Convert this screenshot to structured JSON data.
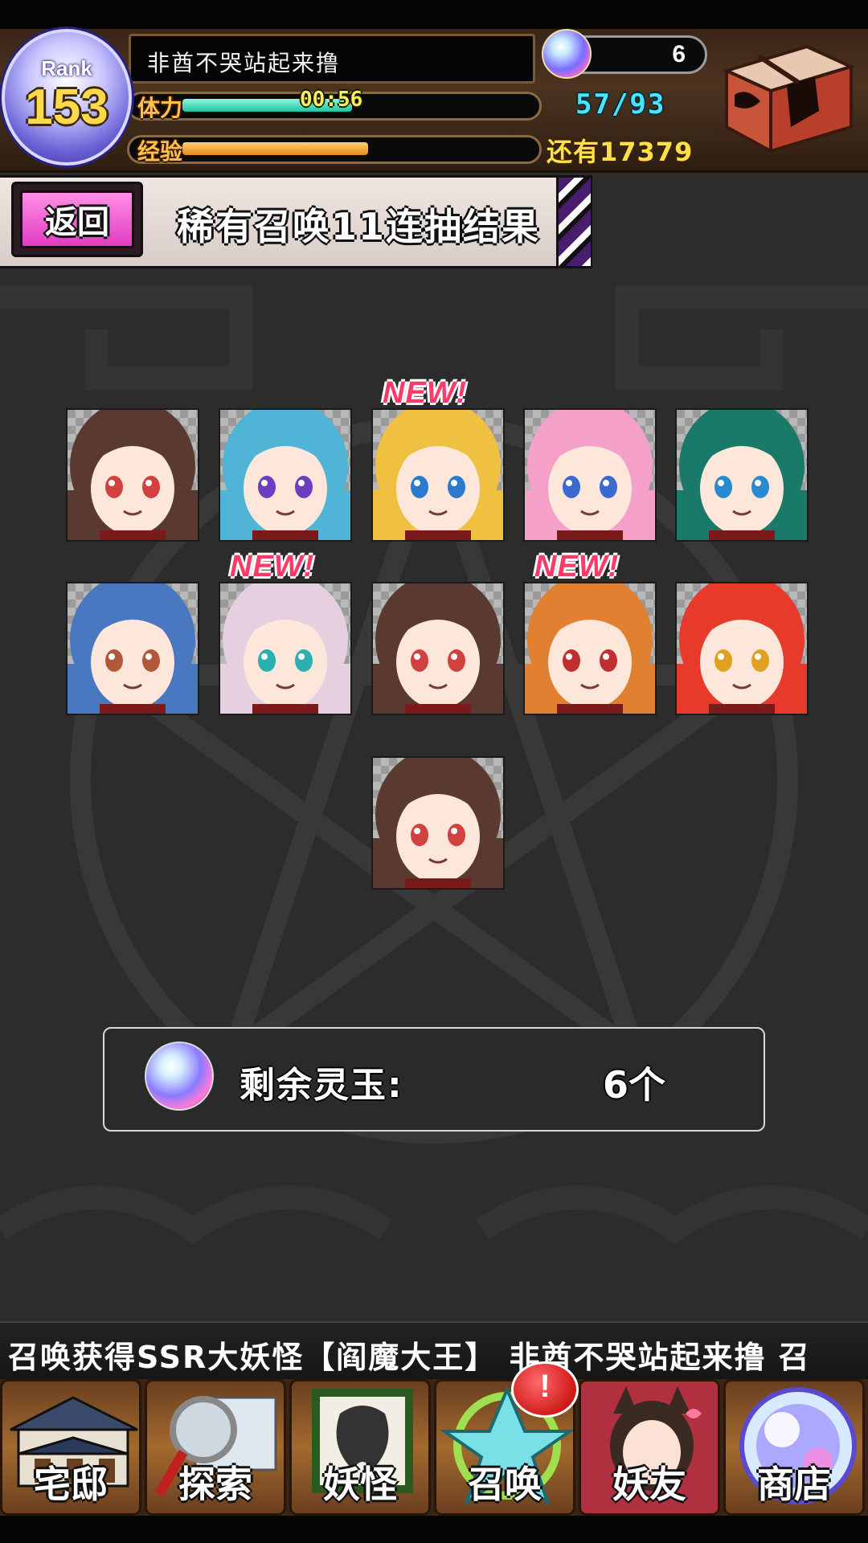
{
  "header": {
    "rank_label": "Rank",
    "rank_value": "153",
    "player_name": "非酋不哭站起来撸",
    "stamina_label": "体力",
    "stamina_timer": "00:56",
    "stamina_fill": 0.64,
    "stamina_readout": "57/93",
    "exp_label": "经验",
    "exp_fill": 0.7,
    "exp_remaining": "还有17379",
    "orb_count": "6",
    "chest_icon": "gift-chest-icon"
  },
  "banner": {
    "back_label": "返回",
    "title": "稀有召唤11连抽结果"
  },
  "results": {
    "new_badge_text": "NEW!",
    "cards": [
      {
        "id": "brown-haired-fox-girl",
        "hair": "#5a3a30",
        "eyes": "#d24040",
        "new": false
      },
      {
        "id": "blue-haired-headphones-boy",
        "hair": "#4fb4d6",
        "eyes": "#6a3fc0",
        "new": false
      },
      {
        "id": "blonde-girl",
        "hair": "#f0c040",
        "eyes": "#2a7ad0",
        "new": true
      },
      {
        "id": "pink-haired-girl",
        "hair": "#f4a0c8",
        "eyes": "#3a6ad0",
        "new": false
      },
      {
        "id": "green-haired-girl",
        "hair": "#1a7a6a",
        "eyes": "#2a8ad0",
        "new": false
      },
      {
        "id": "blue-long-haired-girl",
        "hair": "#4a78c0",
        "eyes": "#b05a3a",
        "new": false
      },
      {
        "id": "silver-haired-girl",
        "hair": "#e6d0e0",
        "eyes": "#2ab0b0",
        "new": true
      },
      {
        "id": "brown-haired-fox-girl",
        "hair": "#5a3a30",
        "eyes": "#d24040",
        "new": false
      },
      {
        "id": "orange-haired-girl",
        "hair": "#e08030",
        "eyes": "#c03030",
        "new": true
      },
      {
        "id": "red-haired-girl",
        "hair": "#e83a2a",
        "eyes": "#e0a020",
        "new": false
      },
      {
        "id": "brown-haired-fox-girl",
        "hair": "#5a3a30",
        "eyes": "#d24040",
        "new": false
      }
    ]
  },
  "orbs_panel": {
    "label": "剩余灵玉:",
    "value": "6个"
  },
  "ticker": {
    "text": "召唤获得SSR大妖怪【阎魔大王】   非酋不哭站起来撸 召"
  },
  "nav": {
    "items": [
      {
        "label": "宅邸",
        "icon": "mansion-icon"
      },
      {
        "label": "探索",
        "icon": "magnifier-map-icon"
      },
      {
        "label": "妖怪",
        "icon": "scroll-icon"
      },
      {
        "label": "召唤",
        "icon": "pentagram-icon"
      },
      {
        "label": "妖友",
        "icon": "fox-girl-icon"
      },
      {
        "label": "商店",
        "icon": "crystal-orb-icon"
      }
    ],
    "alert_text": "!"
  },
  "colors": {
    "stamina_bar": "#2ed8b0",
    "exp_bar": "#f0a030",
    "new_badge": "#ff3a68",
    "back_button": "#e85cc8"
  }
}
